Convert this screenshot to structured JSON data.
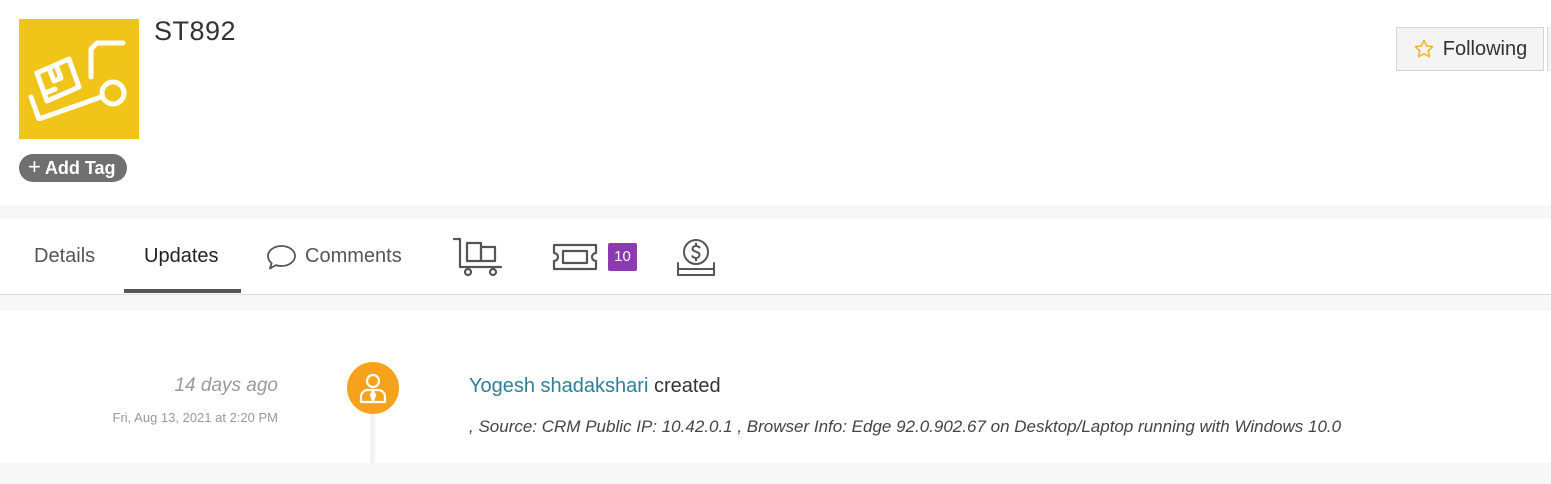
{
  "record": {
    "title": "ST892",
    "add_tag_label": "Add Tag",
    "follow_label": "Following",
    "logo_icon": "truck-dolly-icon",
    "accent": "#f0c419"
  },
  "tabs": [
    {
      "label": "Details"
    },
    {
      "label": "Updates",
      "active": true
    },
    {
      "label": "Comments",
      "icon": "speech-bubble-icon"
    },
    {
      "label": "",
      "icon": "cart-icon"
    },
    {
      "label": "",
      "icon": "ticket-icon",
      "badge": "10"
    },
    {
      "label": "",
      "icon": "money-icon"
    }
  ],
  "badge_color": "#8c3ab1",
  "timeline": {
    "entries": [
      {
        "relative_time": "14 days ago",
        "timestamp": "Fri, Aug 13, 2021 at 2:20 PM",
        "actor": "Yogesh shadakshari",
        "action": "created",
        "detail": ", Source: CRM Public IP: 10.42.0.1 , Browser Info: Edge 92.0.902.67 on Desktop/Laptop running with Windows 10.0",
        "avatar_color": "#f7a21b",
        "actor_color": "#2f7f98"
      }
    ]
  }
}
